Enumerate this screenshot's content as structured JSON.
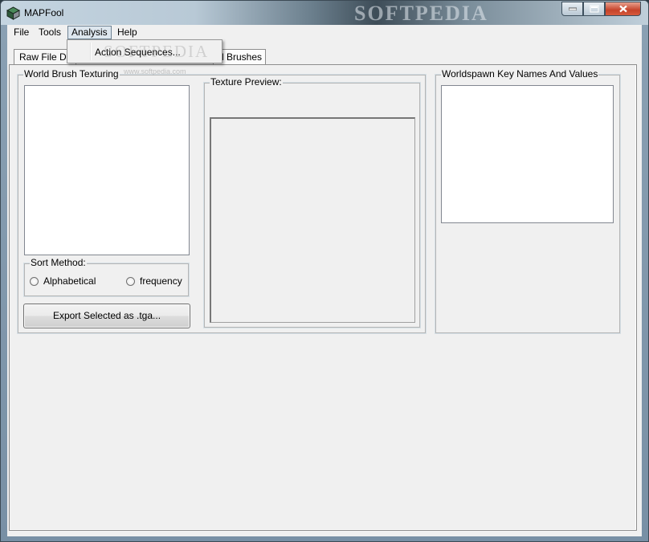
{
  "window": {
    "title": "MAPFool",
    "watermark": "SOFTPEDIA"
  },
  "menu": {
    "items": [
      "File",
      "Tools",
      "Analysis",
      "Help"
    ],
    "active_index": 2,
    "dropdown": {
      "items": [
        "Action Sequences..."
      ]
    }
  },
  "overlay": {
    "watermark": "SOFTPEDIA",
    "url": "www.softpedia.com"
  },
  "tabs": {
    "raw": "Raw File Da",
    "brushes": "d Brushes"
  },
  "world_brush": {
    "title": "World Brush Texturing",
    "sort": {
      "title": "Sort Method:",
      "options": [
        "Alphabetical",
        "frequency"
      ]
    },
    "export_button": "Export Selected as .tga..."
  },
  "texture_preview": {
    "title": "Texture Preview:"
  },
  "worldspawn": {
    "title": "Worldspawn Key Names And Values"
  },
  "icons": {
    "app": "app-cube-icon",
    "minimize": "minimize-icon",
    "maximize": "maximize-icon",
    "close": "close-icon"
  },
  "colors": {
    "close_button": "#c6432a",
    "window_face": "#f0f0f0",
    "listbox": "#ffffff"
  }
}
